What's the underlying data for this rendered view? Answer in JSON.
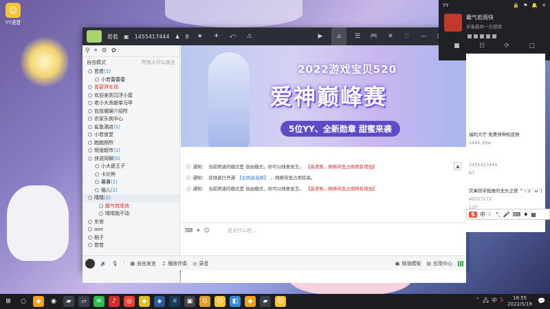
{
  "desktop": {
    "icon_label": "YY语音"
  },
  "window": {
    "title_name": "若若",
    "channel_id": "1455417444",
    "online_count": "8"
  },
  "sidebar": {
    "mode_label": "自由模式",
    "mode_hint": "所有人可以发言",
    "tree": [
      {
        "label": "若若",
        "count": "(1)",
        "level": 0,
        "style": "normal"
      },
      {
        "label": "小若蕾蕾蕾",
        "count": "",
        "level": 1,
        "style": "normal"
      },
      {
        "label": "喜宴停车场",
        "count": "",
        "level": 0,
        "style": "red"
      },
      {
        "label": "欢迎来到沉浮小屋",
        "count": "",
        "level": 0,
        "style": "normal"
      },
      {
        "label": "老小大贡献单马甲",
        "count": "",
        "level": 0,
        "style": "normal"
      },
      {
        "label": "包括微娱介绍所",
        "count": "",
        "level": 0,
        "style": "normal"
      },
      {
        "label": "农家乐宾中心",
        "count": "",
        "level": 0,
        "style": "normal"
      },
      {
        "label": "鲨鱼酒店",
        "count": "(1)",
        "level": 0,
        "style": "normal"
      },
      {
        "label": "小若食堂",
        "count": "",
        "level": 0,
        "style": "normal"
      },
      {
        "label": "跑跑频所",
        "count": "",
        "level": 0,
        "style": "normal"
      },
      {
        "label": "频道超市",
        "count": "(1)",
        "level": 0,
        "style": "normal"
      },
      {
        "label": "快说同聊",
        "count": "(5)",
        "level": 0,
        "style": "normal"
      },
      {
        "label": "小大是王子",
        "count": "",
        "level": 1,
        "style": "normal"
      },
      {
        "label": "卡比熊",
        "count": "",
        "level": 1,
        "style": "normal"
      },
      {
        "label": "薯薯",
        "count": "(1)",
        "level": 1,
        "style": "normal"
      },
      {
        "label": "猫儿",
        "count": "(1)",
        "level": 1,
        "style": "normal"
      },
      {
        "label": "晴晴",
        "count": "(2)",
        "level": 0,
        "style": "sel"
      },
      {
        "label": "霸气若雨快",
        "count": "",
        "level": 2,
        "style": "red"
      },
      {
        "label": "晴晴抱不动",
        "count": "",
        "level": 2,
        "style": "normal"
      },
      {
        "label": "东宫",
        "count": "",
        "level": 0,
        "style": "normal"
      },
      {
        "label": "ooo",
        "count": "",
        "level": 0,
        "style": "normal"
      },
      {
        "label": "桃子",
        "count": "",
        "level": 0,
        "style": "normal"
      },
      {
        "label": "若若",
        "count": "",
        "level": 0,
        "style": "normal"
      }
    ]
  },
  "banner": {
    "title_top": "2022游戏宝贝520",
    "title_main": "爱神巅峰赛",
    "subtitle": "5位YY、全新勋章 甜蜜来袭"
  },
  "notices": [
    {
      "prefix": "通知：",
      "text": "当前频道的模式是 自由模式，你可以随意发言。",
      "link": "【高清质，网络带宽占用稍有增加】"
    },
    {
      "prefix": "通知：",
      "text": "该频道已开通 ",
      "link": "【全频高音质】",
      "tail": "，网络带宽占用较高。"
    },
    {
      "prefix": "通知：",
      "text": "当前频道的模式是 自由模式，你可以随意发言。",
      "link": "【高清质，网络带宽占用稍有增加】"
    }
  ],
  "input": {
    "placeholder": "说点什么吧..."
  },
  "bottombar": {
    "free_speak": "自由发言",
    "playlist": "播放伴奏",
    "record": "录音",
    "channel_template": "频道模板",
    "app_center": "应用中心"
  },
  "notify_panel": {
    "header": "YY",
    "user_name": "霸气若雨快",
    "user_signature": "安着最帅一位搜搜"
  },
  "bg_page": {
    "lines": [
      "福利大厅·免费领神权皮肤",
      "5445.35w",
      "1455417444",
      "67",
      "荧果则学拓推的无头之夜 ^ \\ \\( `ω`)",
      "40717173",
      "137"
    ]
  },
  "ime": {
    "label": "中"
  },
  "taskbar": {
    "time": "18:55",
    "date": "2022/5/19",
    "tray_lang": "中"
  }
}
